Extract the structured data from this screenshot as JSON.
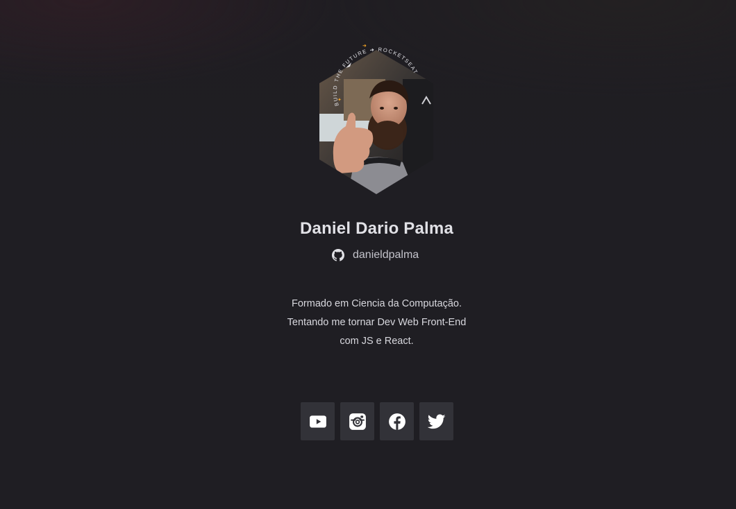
{
  "profile": {
    "name": "Daniel Dario Palma",
    "github_username": "danieldpalma",
    "github_icon": "github-icon",
    "badge_text": "BUILD THE FUTURE · ROCKETSEAT",
    "bio": [
      "Formado em Ciencia da Computação.",
      "Tentando me tornar Dev Web Front-End",
      "com JS e React."
    ]
  },
  "socials": [
    {
      "name": "youtube",
      "icon": "youtube-icon"
    },
    {
      "name": "instagram",
      "icon": "instagram-icon"
    },
    {
      "name": "facebook",
      "icon": "facebook-icon"
    },
    {
      "name": "twitter",
      "icon": "twitter-icon"
    }
  ],
  "colors": {
    "background": "#1f1e23",
    "card_button": "#323238",
    "text_primary": "#e1e1e6",
    "text_secondary": "#c4c4cc",
    "accent": "#f5a524"
  }
}
